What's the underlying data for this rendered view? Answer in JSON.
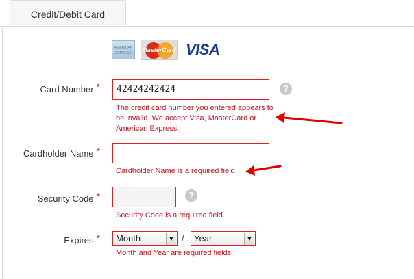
{
  "tab": {
    "label": "Credit/Debit Card"
  },
  "cards": {
    "amex": "AMERICAN EXPRESS",
    "mastercard": "MasterCard",
    "visa": "VISA"
  },
  "form": {
    "card_number": {
      "label": "Card Number",
      "required": "*",
      "value": "42424242424",
      "error_lines": [
        "The credit card number you entered appears to",
        "be invalid. We accept Visa, MasterCard or",
        "American Express."
      ],
      "help": "?"
    },
    "cardholder_name": {
      "label": "Cardholder Name",
      "required": "*",
      "value": "",
      "error": "Cardholder Name is a required field."
    },
    "security_code": {
      "label": "Security Code",
      "required": "*",
      "value": "",
      "error": "Security Code is a required field.",
      "help": "?"
    },
    "expires": {
      "label": "Expires",
      "required": "*",
      "month": "Month",
      "separator": "/",
      "year": "Year",
      "error": "Month and Year are required fields."
    }
  },
  "annotation_color": "#e00000"
}
